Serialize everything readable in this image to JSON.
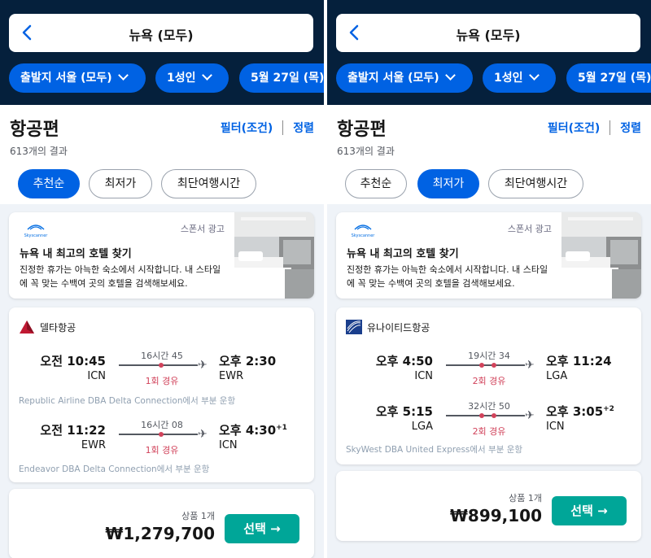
{
  "colors": {
    "navy": "#05203c",
    "brand_blue": "#0062e3",
    "teal": "#00a698",
    "stop_red": "#d1435b"
  },
  "panels": [
    {
      "header": {
        "title": "뉴욕 (모두)",
        "chips": [
          "출발지 서울 (모두)",
          "1성인",
          "5월 27일 (목) -"
        ]
      },
      "heading": "항공편",
      "filter_label": "필터(조건)",
      "sort_label": "정렬",
      "result_count": "613개의 결과",
      "sort_options": [
        "추천순",
        "최저가",
        "최단여행시간"
      ],
      "active_sort": 0,
      "ad": {
        "logo_text": "Skyscanner",
        "tag": "스폰서 광고",
        "title": "뉴욕 내 최고의 호텔 찾기",
        "desc": "진정한 휴가는 아늑한 숙소에서 시작합니다. 내 스타일에 꼭 맞는 수백여 곳의 호텔을 검색해보세요."
      },
      "flight": {
        "airline": "델타항공",
        "logo": "delta-logo-icon",
        "legs": [
          {
            "dep_time": "오전 10:45",
            "dep_code": "ICN",
            "duration": "16시간 45",
            "stops": "1회 경유",
            "arr_time": "오후 2:30",
            "arr_sup": "",
            "arr_code": "EWR"
          },
          {
            "dep_time": "오전 11:22",
            "dep_code": "EWR",
            "duration": "16시간 08",
            "stops": "1회 경유",
            "arr_time": "오후 4:30",
            "arr_sup": "+1",
            "arr_code": "ICN"
          }
        ],
        "operated": [
          "Republic Airline DBA Delta Connection에서 부분 운항",
          "Endeavor DBA Delta Connection에서 부분 운항"
        ]
      },
      "deals": "상품 1개",
      "price": "₩1,279,700",
      "select_label": "선택 →"
    },
    {
      "header": {
        "title": "뉴욕 (모두)",
        "chips": [
          "출발지 서울 (모두)",
          "1성인",
          "5월 27일 (목) -"
        ]
      },
      "heading": "항공편",
      "filter_label": "필터(조건)",
      "sort_label": "정렬",
      "result_count": "613개의 결과",
      "sort_options": [
        "추천순",
        "최저가",
        "최단여행시간"
      ],
      "active_sort": 1,
      "ad": {
        "logo_text": "Skyscanner",
        "tag": "스폰서 광고",
        "title": "뉴욕 내 최고의 호텔 찾기",
        "desc": "진정한 휴가는 아늑한 숙소에서 시작합니다. 내 스타일에 꼭 맞는 수백여 곳의 호텔을 검색해보세요."
      },
      "flight": {
        "airline": "유나이티드항공",
        "logo": "united-logo-icon",
        "legs": [
          {
            "dep_time": "오후 4:50",
            "dep_code": "ICN",
            "duration": "19시간 34",
            "stops": "2회 경유",
            "arr_time": "오후 11:24",
            "arr_sup": "",
            "arr_code": "LGA"
          },
          {
            "dep_time": "오후 5:15",
            "dep_code": "LGA",
            "duration": "32시간 50",
            "stops": "2회 경유",
            "arr_time": "오후 3:05",
            "arr_sup": "+2",
            "arr_code": "ICN"
          }
        ],
        "operated": [
          "SkyWest DBA United Express에서 부분 운항"
        ]
      },
      "deals": "상품 1개",
      "price": "₩899,100",
      "select_label": "선택 →"
    }
  ]
}
